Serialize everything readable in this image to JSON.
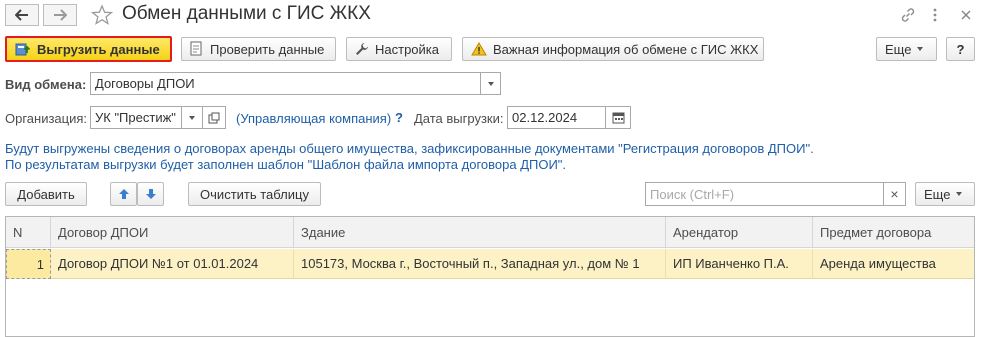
{
  "window": {
    "title": "Обмен данными с ГИС ЖКХ"
  },
  "toolbar": {
    "upload_label": "Выгрузить данные",
    "check_label": "Проверить данные",
    "settings_label": "Настройка",
    "important_label": "Важная информация об обмене с ГИС ЖКХ",
    "more_label": "Еще",
    "help_label": "?"
  },
  "form": {
    "exchange_type_label": "Вид обмена:",
    "exchange_type_value": "Договоры ДПОИ",
    "organization_label": "Организация:",
    "organization_value": "УК \"Престиж\"",
    "organization_role": "(Управляющая компания)",
    "organization_help": "?",
    "date_label": "Дата выгрузки:",
    "date_value": "02.12.2024"
  },
  "info": {
    "line1": "Будут выгружены сведения о договорах аренды общего имущества, зафиксированные документами \"Регистрация договоров ДПОИ\".",
    "line2": "По результатам выгрузки будет заполнен шаблон \"Шаблон файла импорта договора ДПОИ\"."
  },
  "table_toolbar": {
    "add_label": "Добавить",
    "clear_label": "Очистить таблицу",
    "search_placeholder": "Поиск (Ctrl+F)",
    "clear_search": "×",
    "more_label": "Еще"
  },
  "table": {
    "columns": [
      "N",
      "Договор ДПОИ",
      "Здание",
      "Арендатор",
      "Предмет договора"
    ],
    "rows": [
      [
        "1",
        "Договор ДПОИ №1 от 01.01.2024",
        "105173, Москва г., Восточный п., Западная ул., дом № 1",
        "ИП Иванченко П.А.",
        "Аренда имущества"
      ]
    ]
  },
  "colors": {
    "primary_button": "#f5d216",
    "primary_border": "#e51c1c",
    "link": "#1f5fa8",
    "selected_row": "#fcf2c6"
  }
}
